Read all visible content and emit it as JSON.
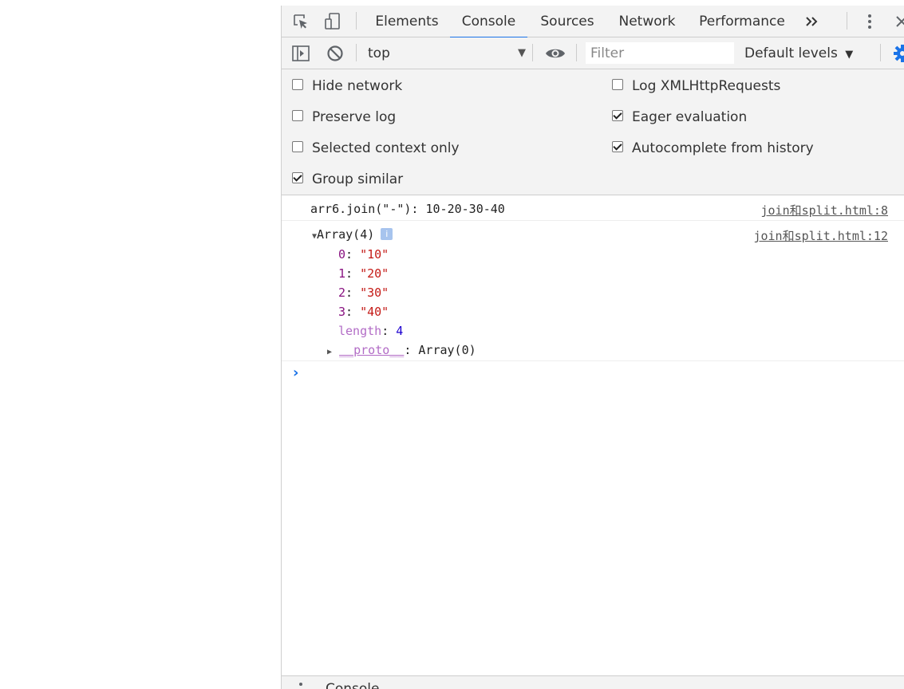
{
  "tabs": [
    {
      "label": "Elements"
    },
    {
      "label": "Console"
    },
    {
      "label": "Sources"
    },
    {
      "label": "Network"
    },
    {
      "label": "Performance"
    }
  ],
  "icons": {
    "inspect": "inspect-element-icon",
    "device": "device-toolbar-icon",
    "more_tabs": "chevron-double-right-icon",
    "menu": "kebab-menu-icon",
    "close": "close-icon",
    "sidebar": "sidebar-toggle-icon",
    "clear": "clear-console-icon",
    "eye": "eye-icon",
    "gear": "gear-icon"
  },
  "toolbar": {
    "context": "top",
    "filter_placeholder": "Filter",
    "levels": "Default levels"
  },
  "settings": {
    "left": [
      {
        "label": "Hide network",
        "checked": false
      },
      {
        "label": "Preserve log",
        "checked": false
      },
      {
        "label": "Selected context only",
        "checked": false
      },
      {
        "label": "Group similar",
        "checked": true
      }
    ],
    "right": [
      {
        "label": "Log XMLHttpRequests",
        "checked": false
      },
      {
        "label": "Eager evaluation",
        "checked": true
      },
      {
        "label": "Autocomplete from history",
        "checked": true
      }
    ]
  },
  "console": {
    "msg1": {
      "text": "arr6.join(\"-\"): 10-20-30-40",
      "source": "join和split.html:8"
    },
    "msg2": {
      "summary": "Array(4)",
      "info": "i",
      "source": "join和split.html:12",
      "items": [
        {
          "key": "0",
          "value": "\"10\""
        },
        {
          "key": "1",
          "value": "\"20\""
        },
        {
          "key": "2",
          "value": "\"30\""
        },
        {
          "key": "3",
          "value": "\"40\""
        }
      ],
      "length_key": "length",
      "length_value": "4",
      "proto_key": "__proto__",
      "proto_value": ": Array(0)"
    },
    "prompt": "›"
  },
  "drawer": {
    "label": "Console"
  },
  "colors": {
    "accent": "#1a73e8",
    "toolbar_bg": "#f3f3f3"
  }
}
